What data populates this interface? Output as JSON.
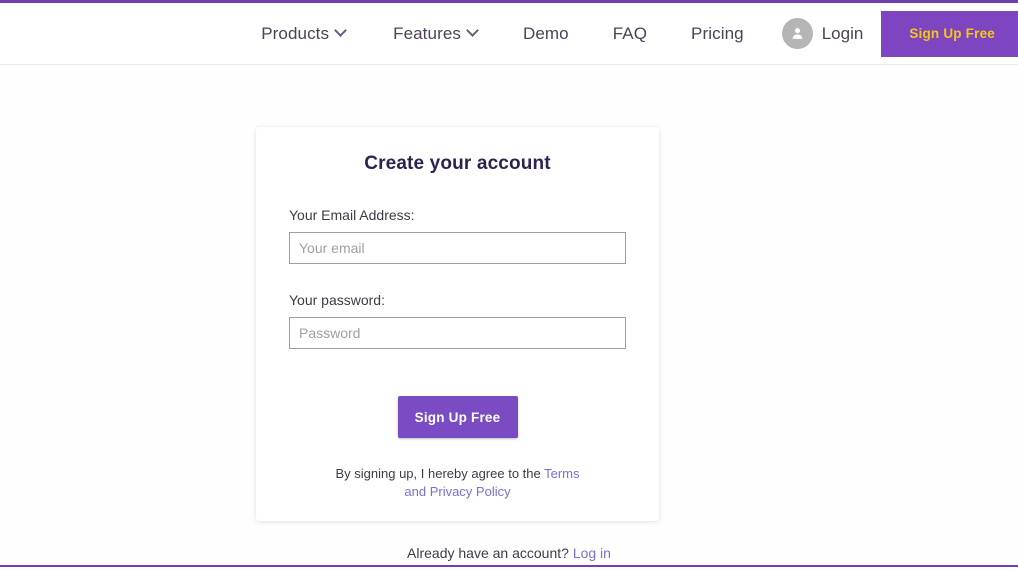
{
  "theme": {
    "accent_purple": "#6f3fb0",
    "button_purple": "#7b4bc4",
    "nav_cta_purple": "#7e45c0",
    "nav_cta_text": "#f5c518",
    "link_purple": "#7b6fd0",
    "heading_color": "#2e2350",
    "page_background": "#ffffff"
  },
  "navbar": {
    "items": [
      {
        "label": "Products",
        "has_dropdown": true,
        "icon": "chevron-down-icon"
      },
      {
        "label": "Features",
        "has_dropdown": true,
        "icon": "chevron-down-icon"
      },
      {
        "label": "Demo",
        "has_dropdown": false,
        "icon": ""
      },
      {
        "label": "FAQ",
        "has_dropdown": false,
        "icon": ""
      },
      {
        "label": "Pricing",
        "has_dropdown": false,
        "icon": ""
      }
    ],
    "login": {
      "label": "Login",
      "avatar_icon": "user-avatar-icon"
    },
    "cta_label": "Sign Up Free"
  },
  "signup_card": {
    "title": "Create your account",
    "email_field": {
      "label": "Your Email Address:",
      "placeholder": "Your email",
      "value": ""
    },
    "password_field": {
      "label": "Your password:",
      "placeholder": "Password",
      "value": ""
    },
    "submit_label": "Sign Up Free",
    "terms_prefix": "By signing up, I hereby agree to the ",
    "terms_link": "Terms and Privacy Policy"
  },
  "footer": {
    "prompt": "Already have an account? ",
    "login_link": "Log in"
  }
}
